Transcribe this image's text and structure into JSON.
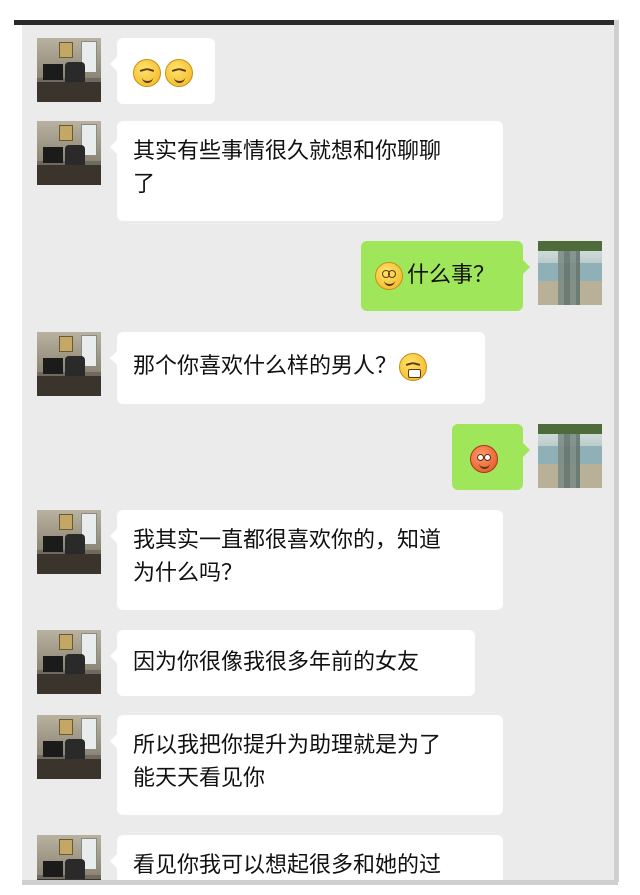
{
  "messages": [
    {
      "side": "left",
      "text": "",
      "emojis": [
        "smirk-emoji",
        "smirk-emoji"
      ]
    },
    {
      "side": "left",
      "line1": "其实有些事情很久就想和你聊聊",
      "line2": "了"
    },
    {
      "side": "right",
      "text": "什么事？",
      "emojis": [
        "dizzy-emoji"
      ]
    },
    {
      "side": "left",
      "text": "那个你喜欢什么样的男人？",
      "emojis": [
        "grin-emoji"
      ]
    },
    {
      "side": "right",
      "text": "",
      "emojis": [
        "blush-emoji"
      ]
    },
    {
      "side": "left",
      "line1": "我其实一直都很喜欢你的，知道",
      "line2": "为什么吗？"
    },
    {
      "side": "left",
      "text": "因为你很像我很多年前的女友"
    },
    {
      "side": "left",
      "line1": "所以我把你提升为助理就是为了",
      "line2": "能天天看见你"
    },
    {
      "side": "left",
      "text": "看见你我可以想起很多和她的过"
    }
  ],
  "colors": {
    "background": "#ebebeb",
    "left_bubble": "#ffffff",
    "right_bubble": "#9fe65a"
  }
}
